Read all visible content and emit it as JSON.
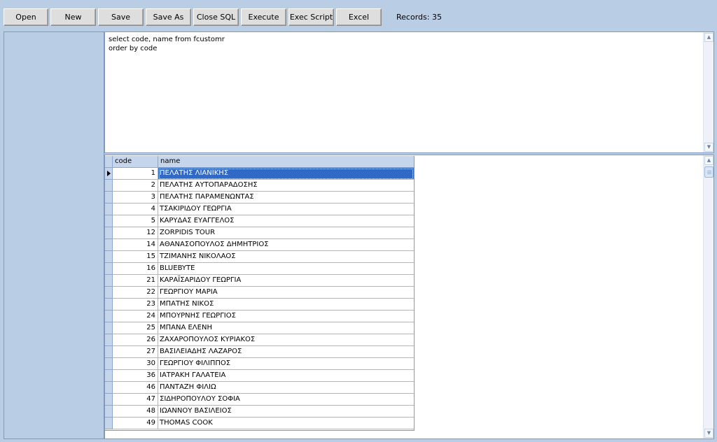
{
  "toolbar": {
    "buttons": [
      "Open",
      "New",
      "Save",
      "Save As",
      "Close SQL",
      "Execute",
      "Exec Script",
      "Excel"
    ],
    "records_label": "Records: 35"
  },
  "sql": {
    "text": "select code, name from fcustomr\norder by code"
  },
  "grid": {
    "columns": [
      "code",
      "name"
    ],
    "selected_row": 0,
    "rows": [
      {
        "code": "1",
        "name": "ΠΕΛΑΤΗΣ ΛΙΑΝΙΚΗΣ"
      },
      {
        "code": "2",
        "name": "ΠΕΛΑΤΗΣ ΑΥΤΟΠΑΡΑΔΟΣΗΣ"
      },
      {
        "code": "3",
        "name": "ΠΕΛΑΤΗΣ ΠΑΡΑΜΕΝΩΝΤΑΣ"
      },
      {
        "code": "4",
        "name": "ΤΣΑΚΙΡΙΔΟΥ ΓΕΩΡΓΙΑ"
      },
      {
        "code": "5",
        "name": "ΚΑΡΥΔΑΣ ΕΥΑΓΓΕΛΟΣ"
      },
      {
        "code": "12",
        "name": "ZORPIDIS TOUR"
      },
      {
        "code": "14",
        "name": "ΑΘΑΝΑΣΟΠΟΥΛΟΣ ΔΗΜΗΤΡΙΟΣ"
      },
      {
        "code": "15",
        "name": "ΤΖΙΜΑΝΗΣ ΝΙΚΟΛΑΟΣ"
      },
      {
        "code": "16",
        "name": "BLUEBYTE"
      },
      {
        "code": "21",
        "name": "ΚΑΡΑΪΣΑΡΙΔΟΥ ΓΕΩΡΓΙΑ"
      },
      {
        "code": "22",
        "name": "ΓΕΩΡΓΙΟΥ ΜΑΡΙΑ"
      },
      {
        "code": "23",
        "name": "ΜΠΑΤΗΣ ΝΙΚΟΣ"
      },
      {
        "code": "24",
        "name": "ΜΠΟΥΡΝΗΣ ΓΕΩΡΓΙΟΣ"
      },
      {
        "code": "25",
        "name": "ΜΠΑΝΑ ΕΛΕΝΗ"
      },
      {
        "code": "26",
        "name": "ΖΑΧΑΡΟΠΟΥΛΟΣ ΚΥΡΙΑΚΟΣ"
      },
      {
        "code": "27",
        "name": "ΒΑΣΙΛΕΙΑΔΗΣ ΛΑΖΑΡΟΣ"
      },
      {
        "code": "30",
        "name": "ΓΕΩΡΓΙΟΥ ΦΙΛΙΠΠΟΣ"
      },
      {
        "code": "36",
        "name": "ΙΑΤΡΑΚΗ ΓΑΛΑΤΕΙΑ"
      },
      {
        "code": "46",
        "name": "ΠΑΝΤΑΖΗ ΦΙΛΙΩ"
      },
      {
        "code": "47",
        "name": "ΣΙΔΗΡΟΠΟΥΛΟΥ ΣΟΦΙΑ"
      },
      {
        "code": "48",
        "name": "ΙΩΑΝΝΟΥ ΒΑΣΙΛΕΙΟΣ"
      },
      {
        "code": "49",
        "name": "THOMAS COOK"
      }
    ]
  },
  "icons": {
    "current_row": "row-pointer-icon",
    "scroll_up": "scroll-up-arrow-icon",
    "scroll_down": "scroll-down-arrow-icon"
  },
  "colors": {
    "background": "#b9cde5",
    "selection": "#3169c6",
    "grid_header": "#c5d6ec"
  }
}
